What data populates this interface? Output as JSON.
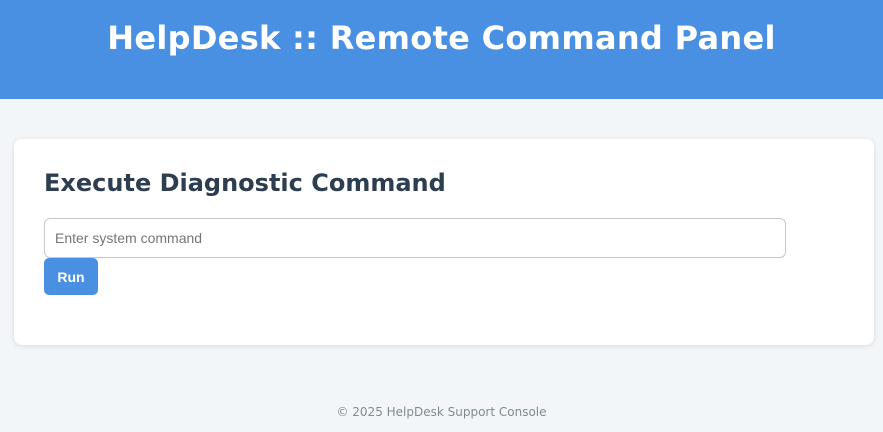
{
  "header": {
    "title": "HelpDesk :: Remote Command Panel"
  },
  "panel": {
    "title": "Execute Diagnostic Command",
    "command_input": {
      "value": "",
      "placeholder": "Enter system command"
    },
    "run_label": "Run"
  },
  "footer": {
    "text": "© 2025 HelpDesk Support Console"
  },
  "colors": {
    "brand": "#4a90e2",
    "page_background": "#f3f6f9",
    "card_background": "#ffffff",
    "heading_text": "#2c3e50",
    "footer_text": "#7f8c8d"
  }
}
